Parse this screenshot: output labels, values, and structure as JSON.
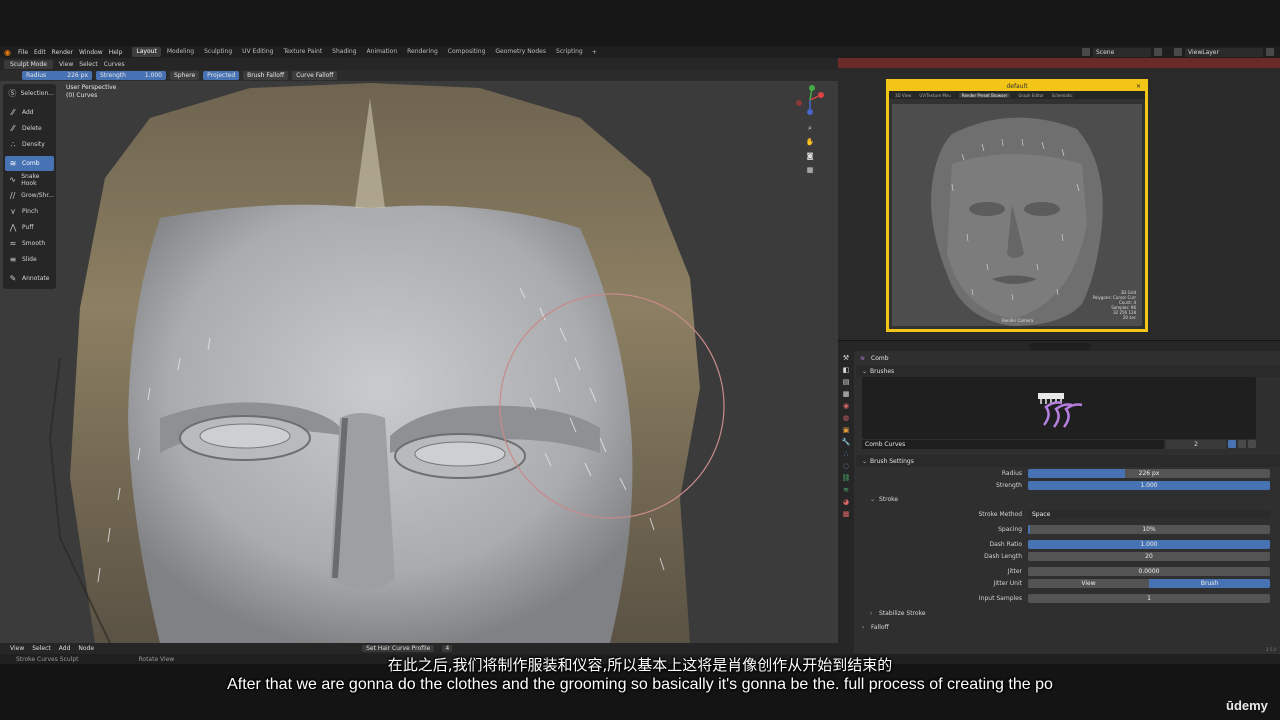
{
  "menu": {
    "items": [
      "File",
      "Edit",
      "Render",
      "Window",
      "Help"
    ],
    "workspaces": [
      "Layout",
      "Modeling",
      "Sculpting",
      "UV Editing",
      "Texture Paint",
      "Shading",
      "Animation",
      "Rendering",
      "Compositing",
      "Geometry Nodes",
      "Scripting"
    ],
    "active_workspace": "Layout",
    "plus": "+",
    "scene": "Scene",
    "view_layer": "ViewLayer"
  },
  "viewport": {
    "mode": "Sculpt Mode",
    "header_menus": [
      "View",
      "Select",
      "Curves"
    ],
    "radius_label": "Radius",
    "radius_value": "226 px",
    "strength_label": "Strength",
    "strength_value": "1.000",
    "sphere": "Sphere",
    "projected": "Projected",
    "brush_falloff": "Brush Falloff",
    "curve_falloff": "Curve Falloff",
    "perspective": "User Perspective",
    "object": "(0) Curves",
    "tools": [
      "Selection...",
      "Add",
      "Delete",
      "Density",
      "Comb",
      "Snake Hook",
      "Grow/Shr...",
      "Pinch",
      "Puff",
      "Smooth",
      "Slide",
      "Annotate"
    ],
    "tool_icons": [
      "Ⓢ",
      "⁄⁄",
      "⁄⁄",
      "∴",
      "≋",
      "∿",
      "∕∕",
      "⋎",
      "⋀",
      "≈",
      "≡",
      "✎"
    ],
    "active_tool": "Comb",
    "footer_menus": [
      "View",
      "Select",
      "Add",
      "Node"
    ],
    "footer_node": "Set Hair Curve Profile",
    "footer_count": "4"
  },
  "status_bar": {
    "left": "Stroke Curves Sculpt",
    "middle": "Rotate View"
  },
  "render_window": {
    "title": "default",
    "tabs": [
      "3D View",
      "UV/Texture Mnu",
      "Render Preset Browser",
      "Graph Editor",
      "Schematic"
    ],
    "active_tab": "Render Preset Browser",
    "camera": "Render Camera",
    "info": [
      "3D Grid",
      "Polygons: Cursor Curr",
      "Count: 4",
      "Samples: 96",
      "32 256 128",
      "20 sec"
    ]
  },
  "properties": {
    "active_brush_title": "Comb",
    "brushes_panel": "Brushes",
    "brush_name": "Comb Curves",
    "brush_users": "2",
    "brush_settings_panel": "Brush Settings",
    "radius_label": "Radius",
    "radius_value": "226 px",
    "radius_fill": 0.4,
    "strength_label": "Strength",
    "strength_value": "1.000",
    "strength_fill": 1.0,
    "stroke_panel": "Stroke",
    "stroke_method_label": "Stroke Method",
    "stroke_method_value": "Space",
    "spacing_label": "Spacing",
    "spacing_value": "10%",
    "spacing_fill": 0.01,
    "dash_ratio_label": "Dash Ratio",
    "dash_ratio_value": "1.000",
    "dash_ratio_fill": 1.0,
    "dash_length_label": "Dash Length",
    "dash_length_value": "20",
    "jitter_label": "Jitter",
    "jitter_value": "0.0000",
    "jitter_unit_label": "Jitter Unit",
    "jitter_unit_options": [
      "View",
      "Brush"
    ],
    "jitter_unit_selected": "Brush",
    "input_samples_label": "Input Samples",
    "input_samples_value": "1",
    "stabilize_panel": "Stabilize Stroke",
    "falloff_panel": "Falloff",
    "version": "3.5.0"
  },
  "subtitles": {
    "chinese": "在此之后,我们将制作服装和仪容,所以基本上这将是肖像创作从开始到结束的",
    "english": "After that we are gonna do the clothes and the grooming so basically it's gonna be the. full process of creating the po"
  },
  "watermark": "ūdemy",
  "colors": {
    "accent_blue": "#4772b3",
    "render_frame": "#f2c516",
    "brush_icon": "#b57fe0",
    "blender_orange": "#e87d0d"
  }
}
